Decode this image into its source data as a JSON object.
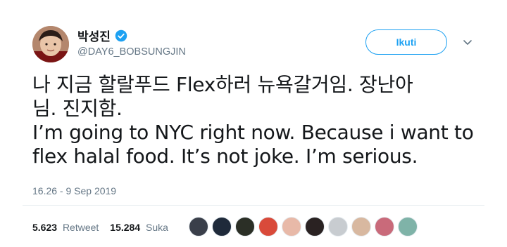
{
  "author": {
    "display_name": "박성진",
    "handle": "@DAY6_BOBSUNGJIN",
    "verified": true
  },
  "follow_button": {
    "label": "Ikuti"
  },
  "tweet": {
    "lines": [
      "나 지금 할랄푸드 Flex하러 뉴욕갈거임. 장난아",
      "님. 진지함.",
      "I’m going to NYC right now. Because i want to",
      "flex halal food. It’s not joke. I’m serious."
    ],
    "timestamp": "16.26 - 9 Sep 2019"
  },
  "stats": {
    "retweets": {
      "count": "5.623",
      "label": "Retweet"
    },
    "likes": {
      "count": "15.284",
      "label": "Suka"
    }
  },
  "likers": [
    {
      "color": "#3a3f4a"
    },
    {
      "color": "#1f2a3a"
    },
    {
      "color": "#2b2f26"
    },
    {
      "color": "#d94a3a"
    },
    {
      "color": "#e8b9a8"
    },
    {
      "color": "#2a2222"
    },
    {
      "color": "#c8ccd0"
    },
    {
      "color": "#d8b8a0"
    },
    {
      "color": "#c96a7a"
    },
    {
      "color": "#7fb3a8"
    }
  ],
  "colors": {
    "accent": "#1da1f2",
    "text": "#14171a",
    "secondary": "#657786"
  }
}
